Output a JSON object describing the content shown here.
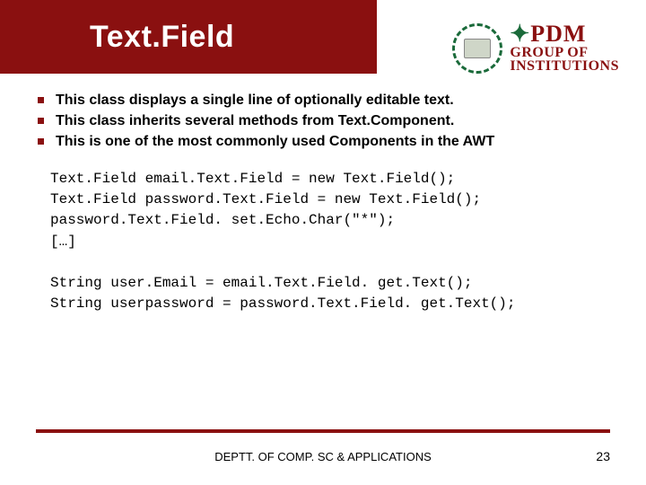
{
  "title": "Text.Field",
  "logo": {
    "line1a": "PD",
    "line1b": "M",
    "line2": "GROUP OF",
    "line3": "INSTITUTIONS"
  },
  "bullets": [
    "This class displays a single line of optionally editable text.",
    "This class inherits several methods from Text.Component.",
    "This is one of the most commonly used Components in the AWT"
  ],
  "code": "Text.Field email.Text.Field = new Text.Field();\nText.Field password.Text.Field = new Text.Field();\npassword.Text.Field. set.Echo.Char(\"*\");\n[…]\n\nString user.Email = email.Text.Field. get.Text();\nString userpassword = password.Text.Field. get.Text();",
  "footer": "DEPTT. OF COMP. SC & APPLICATIONS",
  "page": "23"
}
